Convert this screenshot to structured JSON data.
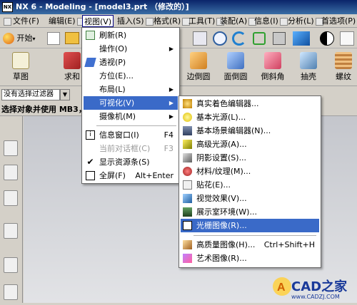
{
  "window": {
    "title": "NX 6 - Modeling - [model3.prt （修改的）]",
    "logo": "NX"
  },
  "menubar": [
    {
      "label": "文件(F)"
    },
    {
      "label": "编辑(E)"
    },
    {
      "label": "视图(V)"
    },
    {
      "label": "插入(S)"
    },
    {
      "label": "格式(R)"
    },
    {
      "label": "工具(T)"
    },
    {
      "label": "装配(A)"
    },
    {
      "label": "信息(I)"
    },
    {
      "label": "分析(L)"
    },
    {
      "label": "首选项(P)"
    }
  ],
  "toolbar": {
    "start": "开始",
    "sketch": "草图",
    "qiuhe": "求和",
    "edge_blend": "边倒圆",
    "face_blend": "面倒圆",
    "chamfer": "倒斜角",
    "shell": "抽壳",
    "thread": "螺纹"
  },
  "filter": {
    "value": "没有选择过滤器"
  },
  "cue": "选择对象并使用 MB3，",
  "view_menu": [
    {
      "label": "刷新(R)",
      "icon": "refresh-icon"
    },
    {
      "label": "操作(O)",
      "arrow": "▶"
    },
    {
      "label": "透视(P)",
      "icon": "perspective-icon"
    },
    {
      "label": "方位(E)..."
    },
    {
      "label": "布局(L)",
      "arrow": "▶"
    },
    {
      "label": "可视化(V)",
      "arrow": "▶"
    },
    {
      "label": "摄像机(M)",
      "arrow": "▶"
    },
    {
      "label": "信息窗口(I)",
      "shortcut": "F4",
      "icon": "info-icon"
    },
    {
      "label": "当前对话框(C)",
      "shortcut": "F3"
    },
    {
      "label": "显示资源条(S)",
      "icon": "check-icon"
    },
    {
      "label": "全屏(F)",
      "shortcut": "Alt+Enter",
      "icon": "fullscreen-icon"
    }
  ],
  "vis_menu": [
    {
      "label": "真实着色编辑器...",
      "icon": "true-shading-icon"
    },
    {
      "label": "基本光源(L)...",
      "icon": "basic-light-icon"
    },
    {
      "label": "基本场景编辑器(N)...",
      "icon": "scene-editor-icon"
    },
    {
      "label": "高级光源(A)...",
      "icon": "advanced-light-icon"
    },
    {
      "label": "阴影设置(S)...",
      "icon": "shadow-icon"
    },
    {
      "label": "材料/纹理(M)...",
      "icon": "material-icon"
    },
    {
      "label": "贴花(E)...",
      "icon": "decal-icon"
    },
    {
      "label": "视觉效果(V)...",
      "icon": "visual-effects-icon"
    },
    {
      "label": "展示室环境(W)...",
      "icon": "showroom-icon"
    },
    {
      "label": "光栅图像(R)...",
      "icon": "raster-image-icon"
    },
    {
      "label": "高质量图像(H)...",
      "shortcut": "Ctrl+Shift+H",
      "icon": "hq-image-icon"
    },
    {
      "label": "艺术图像(R)...",
      "icon": "art-image-icon"
    }
  ],
  "watermark": {
    "brand": "CAD之家",
    "url": "www.CADZJ.COM"
  }
}
